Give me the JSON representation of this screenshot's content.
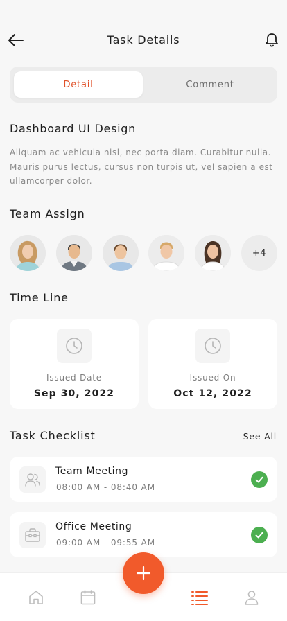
{
  "header": {
    "title": "Task Details"
  },
  "tabs": [
    {
      "label": "Detail",
      "active": true
    },
    {
      "label": "Comment",
      "active": false
    }
  ],
  "task": {
    "title": "Dashboard UI Design",
    "description": "Aliquam ac vehicula nisl, nec porta diam. Curabitur  nulla. Mauris purus lectus, cursus non turpis ut, vel sapien a est ullamcorper dolor."
  },
  "team": {
    "title": "Team Assign",
    "members": [
      "woman-avatar-1",
      "man-avatar-1",
      "man-avatar-2",
      "man-avatar-3",
      "woman-avatar-2"
    ],
    "more_label": "+4"
  },
  "timeline": {
    "title": "Time Line",
    "cards": [
      {
        "label": "Issued Date",
        "value": "Sep 30, 2022",
        "icon": "clock-icon"
      },
      {
        "label": "Issued On",
        "value": "Oct 12, 2022",
        "icon": "clock-icon"
      }
    ]
  },
  "checklist": {
    "title": "Task Checklist",
    "see_all": "See All",
    "items": [
      {
        "name": "Team Meeting",
        "time": "08:00 AM - 08:40 AM",
        "icon": "users-icon",
        "done": true
      },
      {
        "name": "Office Meeting",
        "time": "09:00 AM - 09:55 AM",
        "icon": "briefcase-icon",
        "done": true
      }
    ]
  },
  "nav": {
    "items": [
      "home-icon",
      "calendar-icon",
      "list-icon",
      "profile-icon"
    ],
    "active": "list-icon",
    "fab": "plus-icon"
  },
  "colors": {
    "accent": "#f15a2b",
    "success": "#4caf50",
    "background": "#f7f7f7"
  }
}
